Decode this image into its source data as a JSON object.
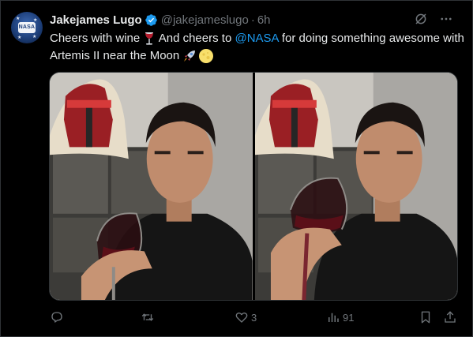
{
  "tweet": {
    "author_name": "Jakejames Lugo",
    "handle": "@jakejameslugo",
    "separator": "·",
    "time": "6h",
    "text_part1": "Cheers with wine ",
    "text_part2": "  And cheers to ",
    "mention": "@NASA",
    "text_part3": " for doing something awesome with Artemis II near the Moon ",
    "emoji": [
      "wine-glass",
      "rocket",
      "full-moon"
    ]
  },
  "avatar": {
    "badge_text": "NASA"
  },
  "stats": {
    "replies": "",
    "retweets": "",
    "likes": "3",
    "views": "91"
  },
  "colors": {
    "accent": "#1d9bf0",
    "muted": "#71767b",
    "text": "#e7e9ea",
    "background": "#000000"
  }
}
